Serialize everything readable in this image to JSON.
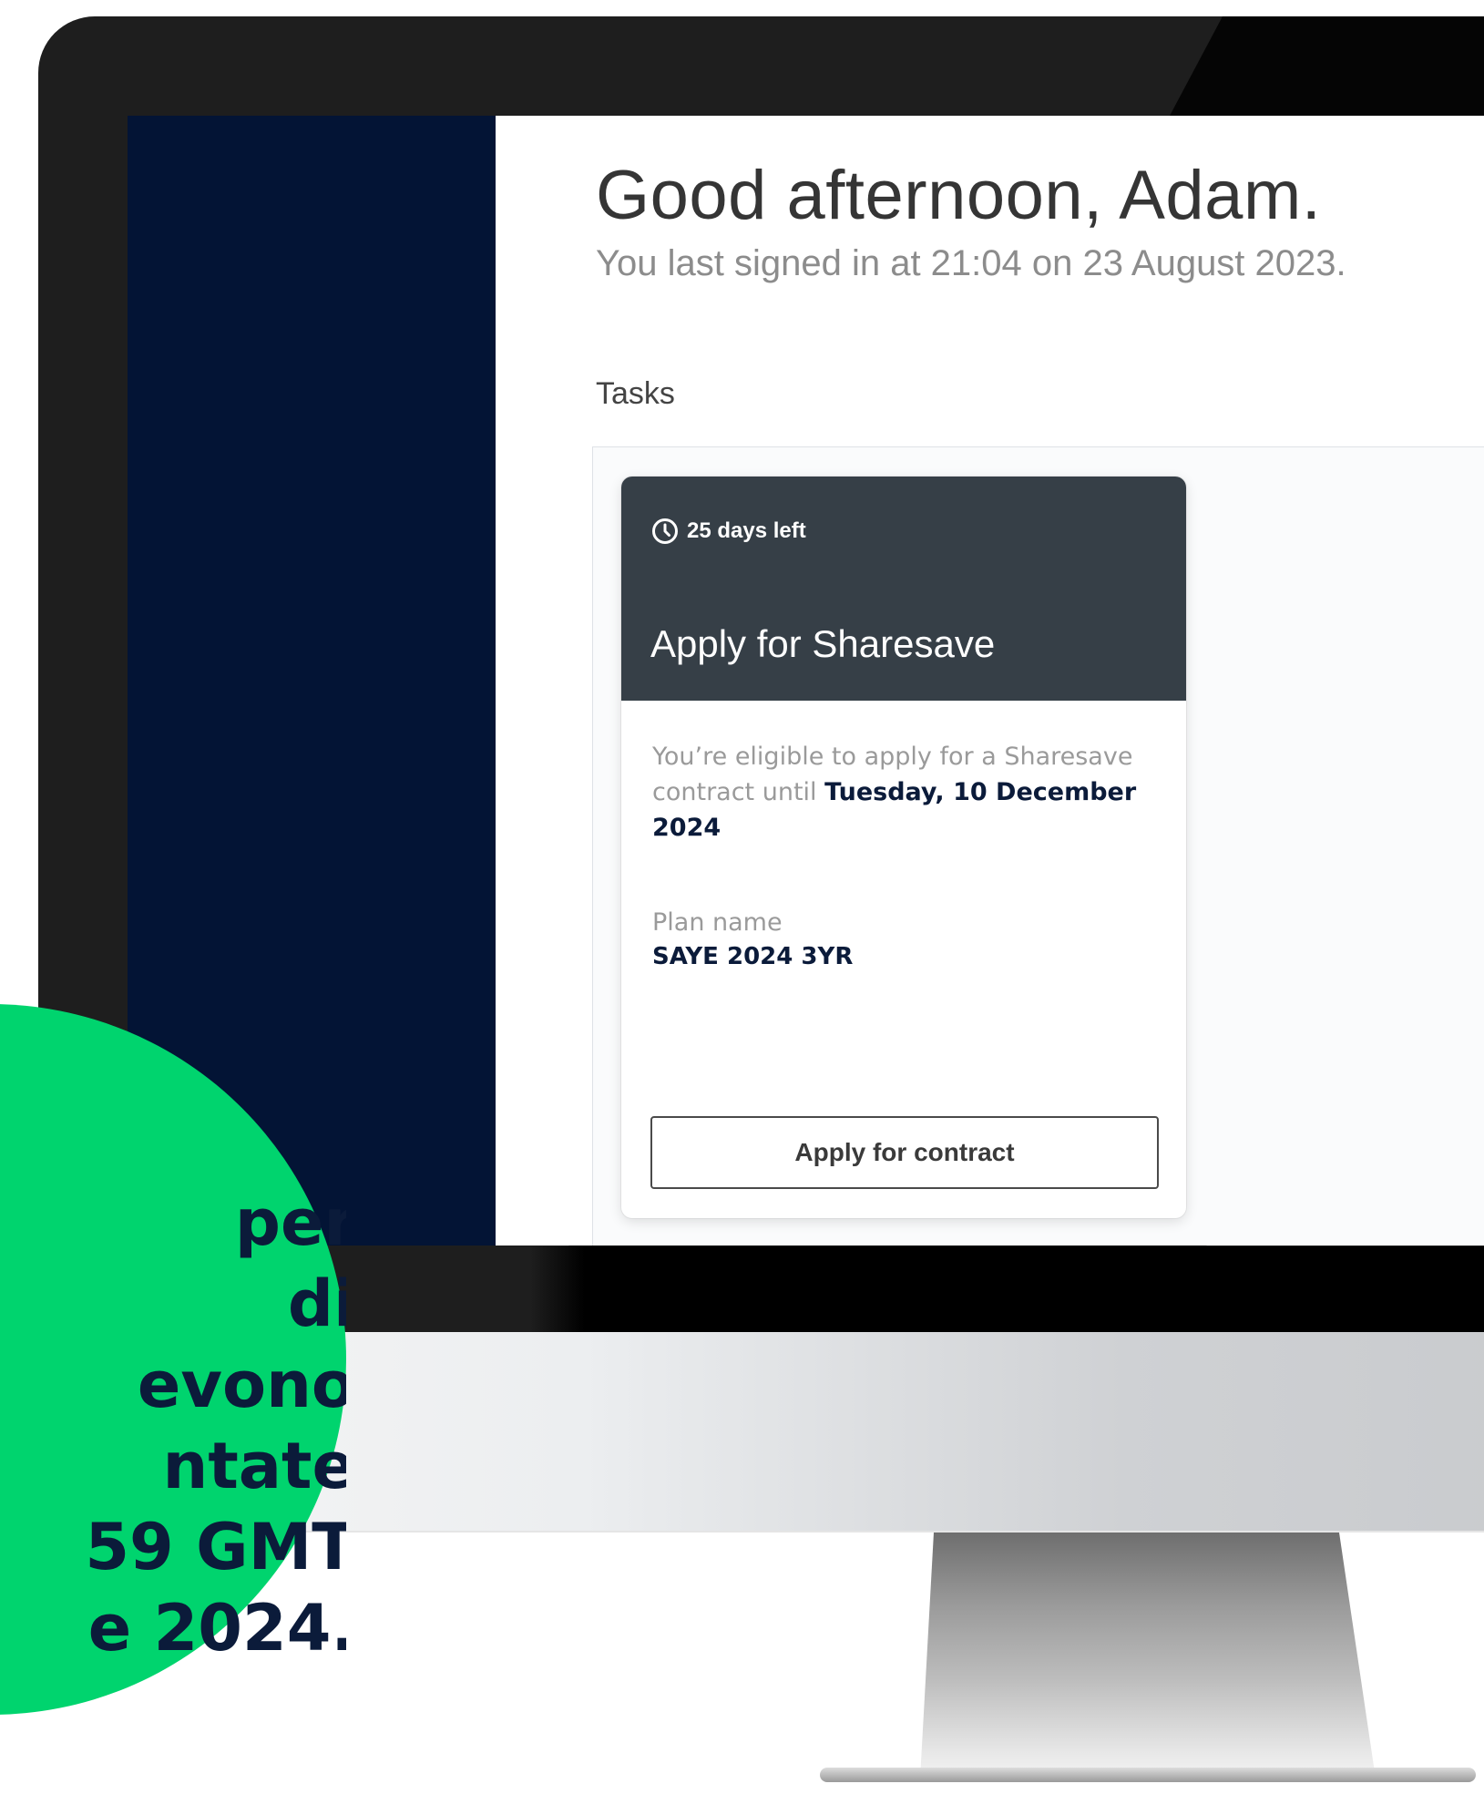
{
  "main": {
    "greeting": "Good afternoon, Adam.",
    "last_signed_in": "You last signed in at 21:04 on 23 August 2023.",
    "tasks_label": "Tasks"
  },
  "task_card": {
    "deadline_icon": "clock-icon",
    "deadline_text": "25 days left",
    "title": "Apply for Sharesave",
    "eligibility_text": "You’re eligible to apply for a Sharesave contract until",
    "eligibility_date": "Tuesday, 10 December 2024",
    "plan_label": "Plan name",
    "plan_value": "SAYE 2024 3YR",
    "button_label": "Apply for contract"
  },
  "callout": {
    "lines": [
      "per",
      "di",
      "evono",
      "ntate",
      "59 GMT",
      "e 2024."
    ]
  },
  "colors": {
    "sidebar": "#031435",
    "card_header": "#363f47",
    "callout_bubble": "#00d46e",
    "text_dark": "#0b1b3a"
  }
}
